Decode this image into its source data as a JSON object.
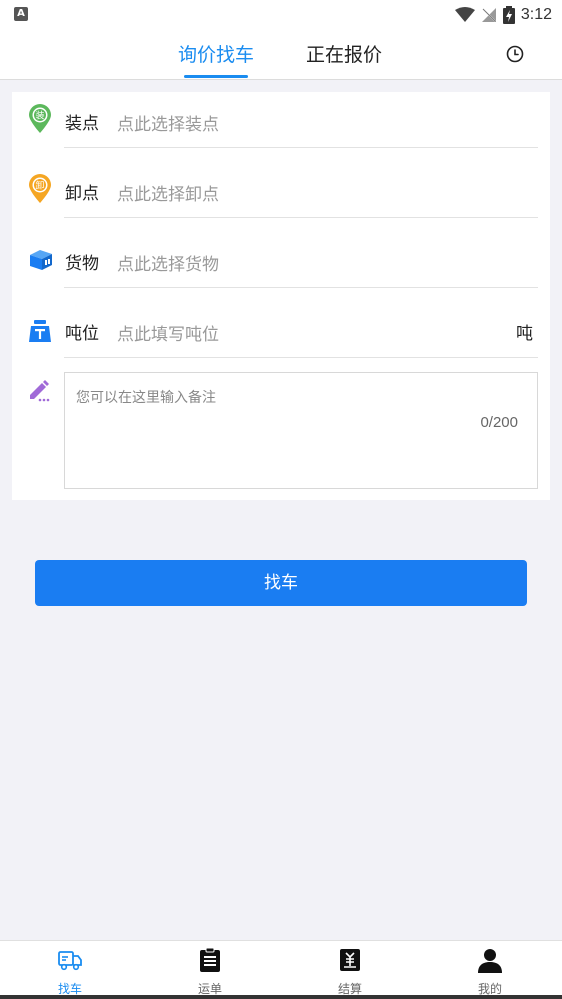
{
  "status_bar": {
    "time": "3:12",
    "indicator": "A"
  },
  "top_nav": {
    "tabs": [
      {
        "label": "询价找车",
        "active": true
      },
      {
        "label": "正在报价",
        "active": false
      }
    ],
    "history_icon": "clock-icon"
  },
  "form": {
    "loading": {
      "label": "装点",
      "placeholder": "点此选择装点",
      "icon": "pin-icon",
      "badge": "装"
    },
    "unloading": {
      "label": "卸点",
      "placeholder": "点此选择卸点",
      "icon": "pin-icon",
      "badge": "卸"
    },
    "cargo": {
      "label": "货物",
      "placeholder": "点此选择货物",
      "icon": "box-icon"
    },
    "tonnage": {
      "label": "吨位",
      "placeholder": "点此填写吨位",
      "unit": "吨",
      "icon": "weight-icon"
    },
    "note": {
      "placeholder": "您可以在这里输入备注",
      "counter": "0/200",
      "icon": "pencil-icon"
    }
  },
  "find_button": {
    "label": "找车"
  },
  "bottom_nav": {
    "items": [
      {
        "label": "找车",
        "icon": "truck-icon",
        "active": true
      },
      {
        "label": "运单",
        "icon": "clipboard-icon",
        "active": false
      },
      {
        "label": "结算",
        "icon": "settlement-icon",
        "active": false
      },
      {
        "label": "我的",
        "icon": "person-icon",
        "active": false
      }
    ]
  },
  "colors": {
    "accent": "#1a8cf0",
    "button": "#1a7df2",
    "loading_green": "#5cb85c",
    "unloading_orange": "#f5a623",
    "cargo_blue": "#1a7df2",
    "note_purple": "#a06ad8"
  }
}
